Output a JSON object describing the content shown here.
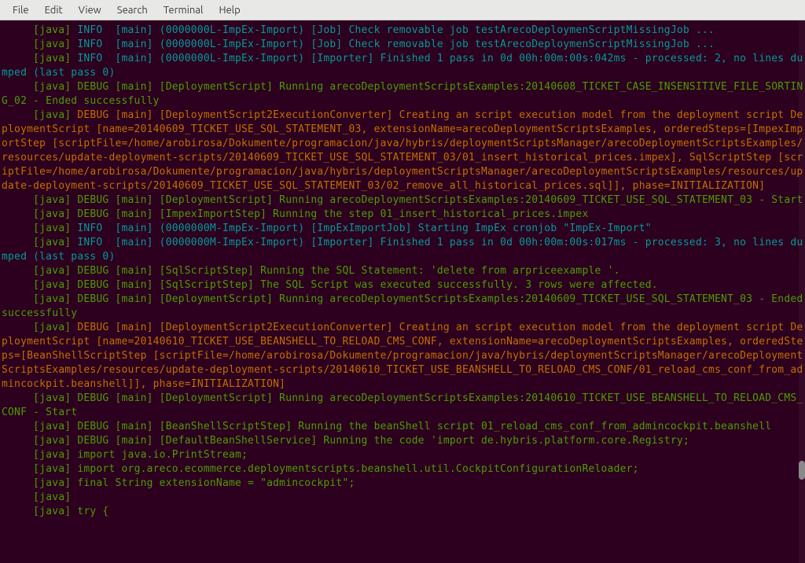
{
  "menu": {
    "items": [
      "File",
      "Edit",
      "View",
      "Search",
      "Terminal",
      "Help"
    ]
  },
  "colors": {
    "bg": "#2c001e",
    "green": "#4e9a06",
    "cyan": "#06989a",
    "orange": "#c46f00",
    "default": "#eeeeec"
  },
  "lines": [
    [
      {
        "c": "default",
        "t": "     "
      },
      {
        "c": "green",
        "t": "[java] "
      },
      {
        "c": "cyan",
        "t": "INFO  [main] (0000000L-ImpEx-Import) [Job] Check removable job testArecoDeploymenScriptMissingJob ..."
      }
    ],
    [
      {
        "c": "default",
        "t": "     "
      },
      {
        "c": "green",
        "t": "[java] "
      },
      {
        "c": "cyan",
        "t": "INFO  [main] (0000000L-ImpEx-Import) [Job] Check removable job testArecoDeploymenScriptMissingJob ..."
      }
    ],
    [
      {
        "c": "default",
        "t": "     "
      },
      {
        "c": "green",
        "t": "[java] "
      },
      {
        "c": "cyan",
        "t": "INFO  [main] (0000000L-ImpEx-Import) [Importer] Finished 1 pass in 0d 00h:00m:00s:042ms - processed: 2, no lines dumped (last pass 0)"
      }
    ],
    [
      {
        "c": "default",
        "t": "     "
      },
      {
        "c": "green",
        "t": "[java] DEBUG [main] [DeploymentScript] Running arecoDeploymentScriptsExamples:20140608_TICKET_CASE_INSENSITIVE_FILE_SORTING_02 - Ended successfully"
      }
    ],
    [
      {
        "c": "default",
        "t": "     "
      },
      {
        "c": "green",
        "t": "[java] "
      },
      {
        "c": "orange",
        "t": "DEBUG [main] [DeploymentScript2ExecutionConverter] Creating an script execution model from the deployment script DeploymentScript [name=20140609_TICKET_USE_SQL_STATEMENT_03, extensionName=arecoDeploymentScriptsExamples, orderedSteps=[ImpexImportStep [scriptFile=/home/arobirosa/Dokumente/programacion/java/hybris/deploymentScriptsManager/arecoDeploymentScriptsExamples/resources/update-deployment-scripts/20140609_TICKET_USE_SQL_STATEMENT_03/01_insert_historical_prices.impex], SqlScriptStep [scriptFile=/home/arobirosa/Dokumente/programacion/java/hybris/deploymentScriptsManager/arecoDeploymentScriptsExamples/resources/update-deployment-scripts/20140609_TICKET_USE_SQL_STATEMENT_03/02_remove_all_historical_prices.sql]], phase=INITIALIZATION]"
      }
    ],
    [
      {
        "c": "default",
        "t": "     "
      },
      {
        "c": "green",
        "t": "[java] DEBUG [main] [DeploymentScript] Running arecoDeploymentScriptsExamples:20140609_TICKET_USE_SQL_STATEMENT_03 - Start"
      }
    ],
    [
      {
        "c": "default",
        "t": "     "
      },
      {
        "c": "green",
        "t": "[java] DEBUG [main] [ImpexImportStep] Running the step 01_insert_historical_prices.impex"
      }
    ],
    [
      {
        "c": "default",
        "t": "     "
      },
      {
        "c": "green",
        "t": "[java] "
      },
      {
        "c": "cyan",
        "t": "INFO  [main] (0000000M-ImpEx-Import) [ImpExImportJob] Starting ImpEx cronjob \"ImpEx-Import\""
      }
    ],
    [
      {
        "c": "default",
        "t": "     "
      },
      {
        "c": "green",
        "t": "[java] "
      },
      {
        "c": "cyan",
        "t": "INFO  [main] (0000000M-ImpEx-Import) [Importer] Finished 1 pass in 0d 00h:00m:00s:017ms - processed: 3, no lines dumped (last pass 0)"
      }
    ],
    [
      {
        "c": "default",
        "t": "     "
      },
      {
        "c": "green",
        "t": "[java] DEBUG [main] [SqlScriptStep] Running the SQL Statement: 'delete from arpriceexample '."
      }
    ],
    [
      {
        "c": "default",
        "t": "     "
      },
      {
        "c": "green",
        "t": "[java] DEBUG [main] [SqlScriptStep] The SQL Script was executed successfully. 3 rows were affected."
      }
    ],
    [
      {
        "c": "default",
        "t": "     "
      },
      {
        "c": "green",
        "t": "[java] DEBUG [main] [DeploymentScript] Running arecoDeploymentScriptsExamples:20140609_TICKET_USE_SQL_STATEMENT_03 - Ended successfully"
      }
    ],
    [
      {
        "c": "default",
        "t": "     "
      },
      {
        "c": "green",
        "t": "[java] "
      },
      {
        "c": "orange",
        "t": "DEBUG [main] [DeploymentScript2ExecutionConverter] Creating an script execution model from the deployment script DeploymentScript [name=20140610_TICKET_USE_BEANSHELL_TO_RELOAD_CMS_CONF, extensionName=arecoDeploymentScriptsExamples, orderedSteps=[BeanShellScriptStep [scriptFile=/home/arobirosa/Dokumente/programacion/java/hybris/deploymentScriptsManager/arecoDeploymentScriptsExamples/resources/update-deployment-scripts/20140610_TICKET_USE_BEANSHELL_TO_RELOAD_CMS_CONF/01_reload_cms_conf_from_admincockpit.beanshell]], phase=INITIALIZATION]"
      }
    ],
    [
      {
        "c": "default",
        "t": "     "
      },
      {
        "c": "green",
        "t": "[java] DEBUG [main] [DeploymentScript] Running arecoDeploymentScriptsExamples:20140610_TICKET_USE_BEANSHELL_TO_RELOAD_CMS_CONF - Start"
      }
    ],
    [
      {
        "c": "default",
        "t": "     "
      },
      {
        "c": "green",
        "t": "[java] DEBUG [main] [BeanShellScriptStep] Running the beanShell script 01_reload_cms_conf_from_admincockpit.beanshell"
      }
    ],
    [
      {
        "c": "default",
        "t": "     "
      },
      {
        "c": "green",
        "t": "[java] DEBUG [main] [DefaultBeanShellService] Running the code 'import de.hybris.platform.core.Registry;"
      }
    ],
    [
      {
        "c": "default",
        "t": "     "
      },
      {
        "c": "green",
        "t": "[java] import java.io.PrintStream;"
      }
    ],
    [
      {
        "c": "default",
        "t": "     "
      },
      {
        "c": "green",
        "t": "[java] import org.areco.ecommerce.deploymentscripts.beanshell.util.CockpitConfigurationReloader;"
      }
    ],
    [
      {
        "c": "default",
        "t": "     "
      },
      {
        "c": "green",
        "t": "[java] final String extensionName = \"admincockpit\";"
      }
    ],
    [
      {
        "c": "default",
        "t": "     "
      },
      {
        "c": "green",
        "t": "[java] "
      }
    ],
    [
      {
        "c": "default",
        "t": "     "
      },
      {
        "c": "green",
        "t": "[java] try {"
      }
    ]
  ]
}
